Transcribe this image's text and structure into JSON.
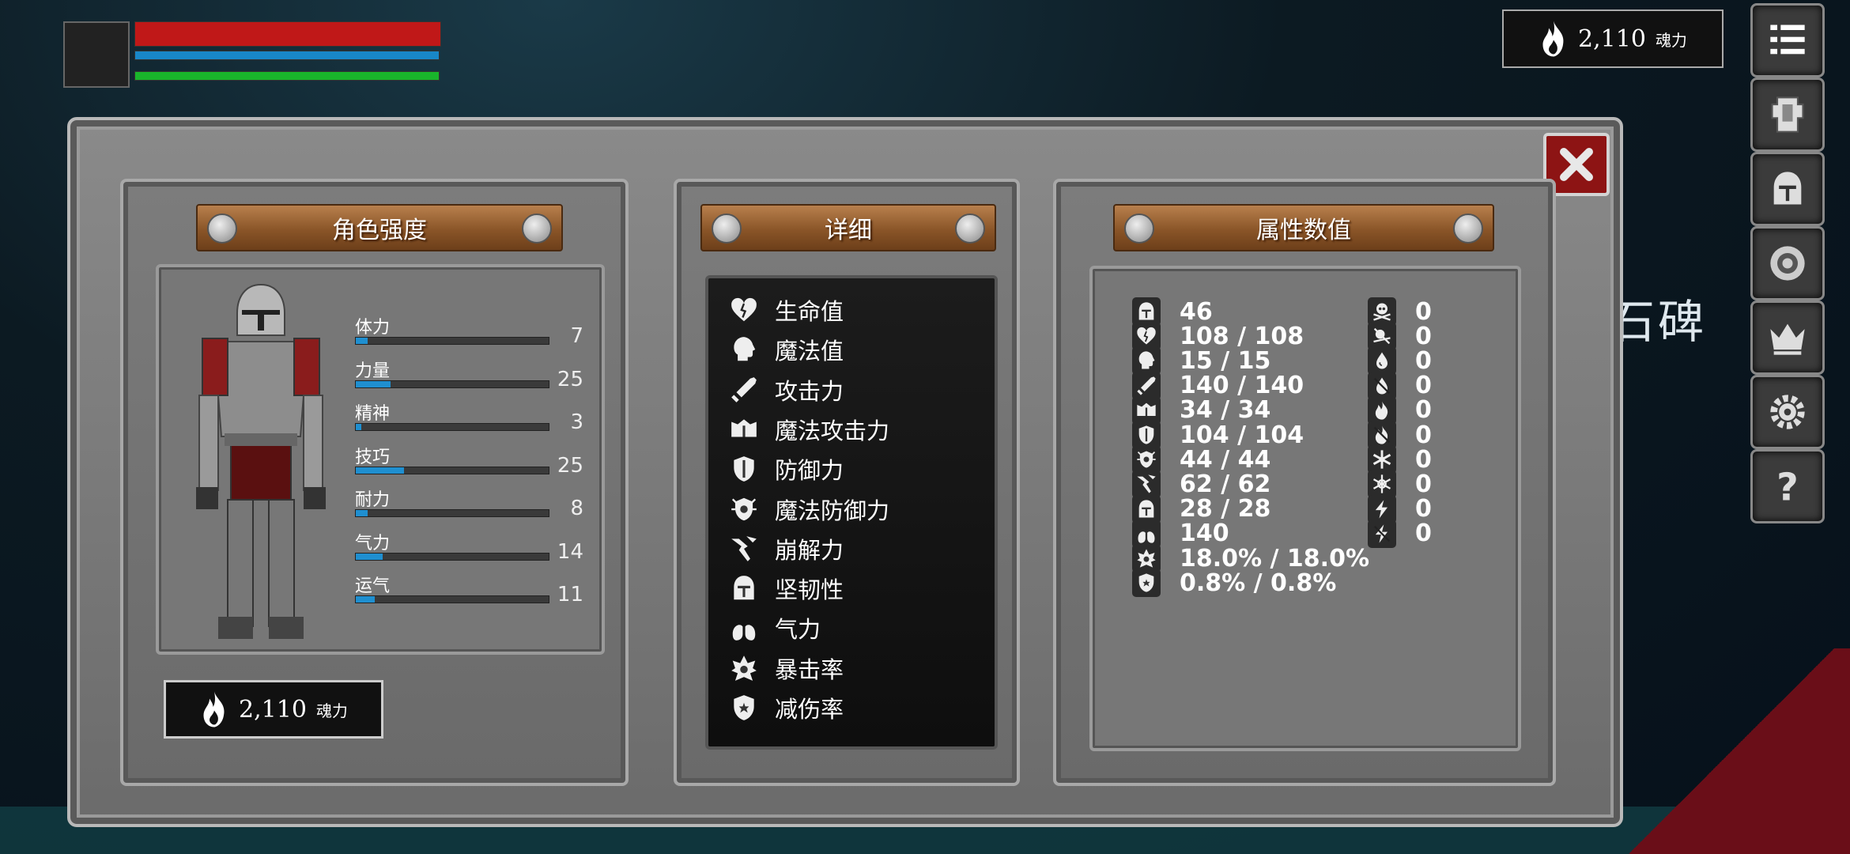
{
  "hud": {
    "hp_fraction": 1.0,
    "mp_fraction": 1.0,
    "stamina_fraction": 1.0,
    "soul_amount": "2,110",
    "soul_unit": "魂力"
  },
  "side_menu": [
    "list-icon",
    "armor-icon",
    "helmet-icon",
    "coin-icon",
    "crown-icon",
    "gear-icon",
    "question-icon"
  ],
  "bg_text": "石碑",
  "panels": {
    "character": {
      "title": "角色强度",
      "stats": [
        {
          "label": "体力",
          "value": "7",
          "fraction": 0.06
        },
        {
          "label": "力量",
          "value": "25",
          "fraction": 0.18
        },
        {
          "label": "精神",
          "value": "3",
          "fraction": 0.03
        },
        {
          "label": "技巧",
          "value": "25",
          "fraction": 0.25
        },
        {
          "label": "耐力",
          "value": "8",
          "fraction": 0.06
        },
        {
          "label": "气力",
          "value": "14",
          "fraction": 0.14
        },
        {
          "label": "运气",
          "value": "11",
          "fraction": 0.1
        }
      ],
      "soul_amount": "2,110",
      "soul_unit": "魂力"
    },
    "detail": {
      "title": "详细",
      "rows": [
        {
          "icon": "heart-icon",
          "label": "生命值"
        },
        {
          "icon": "head-icon",
          "label": "魔法值"
        },
        {
          "icon": "sword-icon",
          "label": "攻击力"
        },
        {
          "icon": "book-icon",
          "label": "魔法攻击力"
        },
        {
          "icon": "shield-icon",
          "label": "防御力"
        },
        {
          "icon": "magic-shield-icon",
          "label": "魔法防御力"
        },
        {
          "icon": "break-icon",
          "label": "崩解力"
        },
        {
          "icon": "helmet-icon",
          "label": "坚韧性"
        },
        {
          "icon": "lungs-icon",
          "label": "气力"
        },
        {
          "icon": "crit-icon",
          "label": "暴击率"
        },
        {
          "icon": "reduction-icon",
          "label": "减伤率"
        }
      ]
    },
    "attributes": {
      "title": "属性数值",
      "left": [
        {
          "icon": "helmet-icon",
          "value": "46"
        },
        {
          "icon": "heart-icon",
          "value": "108 / 108"
        },
        {
          "icon": "head-icon",
          "value": "15 / 15"
        },
        {
          "icon": "sword-icon",
          "value": "140 / 140"
        },
        {
          "icon": "book-icon",
          "value": "34 / 34"
        },
        {
          "icon": "shield-icon",
          "value": "104 / 104"
        },
        {
          "icon": "magic-shield-icon",
          "value": "44 / 44"
        },
        {
          "icon": "break-icon",
          "value": "62 / 62"
        },
        {
          "icon": "helmet-icon",
          "value": "28 / 28"
        },
        {
          "icon": "lungs-icon",
          "value": "140"
        },
        {
          "icon": "crit-icon",
          "value": "18.0% / 18.0%"
        },
        {
          "icon": "reduction-icon",
          "value": "0.8% / 0.8%"
        }
      ],
      "right": [
        {
          "icon": "skull-icon",
          "value": "0"
        },
        {
          "icon": "poison-icon",
          "value": "0"
        },
        {
          "icon": "bleed-icon",
          "value": "0"
        },
        {
          "icon": "bleed-res-icon",
          "value": "0"
        },
        {
          "icon": "fire-icon",
          "value": "0"
        },
        {
          "icon": "fire-res-icon",
          "value": "0"
        },
        {
          "icon": "frost-icon",
          "value": "0"
        },
        {
          "icon": "frost-res-icon",
          "value": "0"
        },
        {
          "icon": "lightning-icon",
          "value": "0"
        },
        {
          "icon": "lightning-res-icon",
          "value": "0"
        }
      ]
    }
  }
}
